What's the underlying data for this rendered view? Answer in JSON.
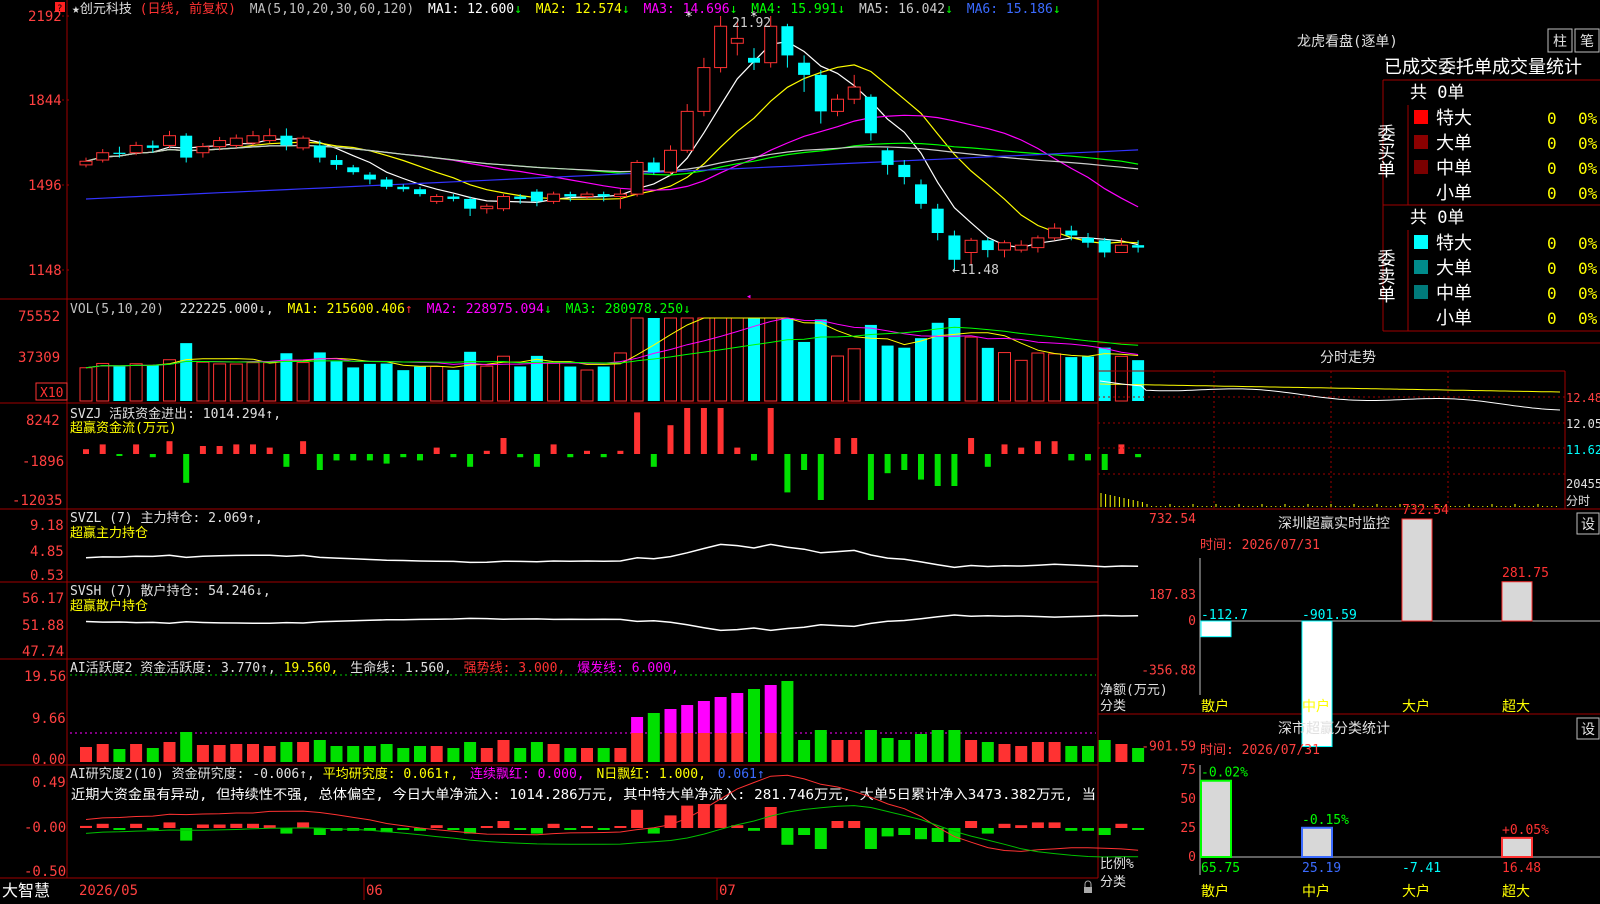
{
  "colors": {
    "up": "#ff3232",
    "down": "#00ffff",
    "flow_neg": "#00e000",
    "ma1": "#ffffff",
    "ma2": "#ffff00",
    "ma3": "#ff00ff",
    "ma4": "#00ff00",
    "ma5": "#cccccc",
    "ma6": "#3333ff",
    "axis": "#c01010",
    "label_yellow": "#ffff00",
    "magenta": "#ff00ff"
  },
  "corner_marker": "?",
  "app_name": "大智慧",
  "lock_icon": "lock-icon",
  "main_chart": {
    "stock_name": "★创元科技",
    "period_label": "(日线, 前复权)",
    "ma_title": "MA(5,10,20,30,60,120)",
    "ma_labels": [
      {
        "text": "MA1: 12.600",
        "arrow": "↓",
        "color_key": "ma1"
      },
      {
        "text": "MA2: 12.574",
        "arrow": "↓",
        "color_key": "ma2"
      },
      {
        "text": "MA3: 14.696",
        "arrow": "↓",
        "color_key": "ma3"
      },
      {
        "text": "MA4: 15.991",
        "arrow": "↓",
        "color_key": "ma4"
      },
      {
        "text": "MA5: 16.042",
        "arrow": "↓",
        "color_key": "ma5"
      },
      {
        "text": "MA6: 15.186",
        "arrow": "↓",
        "color_key": "ma6"
      }
    ],
    "y_ticks": [
      "2192",
      "1844",
      "1496",
      "1148"
    ],
    "high_label": "21.92",
    "low_label": "←11.48"
  },
  "candles": [
    [
      15.8,
      15.95,
      16.1,
      15.7
    ],
    [
      16.0,
      16.3,
      16.45,
      15.9
    ],
    [
      16.3,
      16.25,
      16.55,
      16.1
    ],
    [
      16.3,
      16.6,
      16.75,
      16.2
    ],
    [
      16.6,
      16.5,
      16.8,
      16.3
    ],
    [
      16.6,
      17.0,
      17.2,
      16.5
    ],
    [
      17.0,
      16.1,
      17.1,
      15.9
    ],
    [
      16.3,
      16.55,
      16.7,
      16.1
    ],
    [
      16.55,
      16.8,
      16.95,
      16.4
    ],
    [
      16.6,
      16.9,
      17.05,
      16.5
    ],
    [
      16.7,
      17.0,
      17.2,
      16.6
    ],
    [
      16.8,
      17.0,
      17.3,
      16.7
    ],
    [
      17.0,
      16.6,
      17.3,
      16.4
    ],
    [
      16.5,
      16.9,
      17.0,
      16.4
    ],
    [
      16.6,
      16.1,
      16.8,
      15.9
    ],
    [
      16.0,
      15.8,
      16.2,
      15.6
    ],
    [
      15.7,
      15.5,
      15.8,
      15.4
    ],
    [
      15.4,
      15.2,
      15.5,
      15.0
    ],
    [
      15.2,
      14.9,
      15.3,
      14.8
    ],
    [
      14.9,
      14.8,
      15.0,
      14.7
    ],
    [
      14.8,
      14.6,
      14.9,
      14.5
    ],
    [
      14.3,
      14.5,
      14.6,
      14.2
    ],
    [
      14.5,
      14.4,
      14.6,
      14.3
    ],
    [
      14.4,
      14.0,
      14.5,
      13.7
    ],
    [
      14.0,
      14.1,
      14.2,
      13.8
    ],
    [
      14.0,
      14.5,
      14.6,
      13.9
    ],
    [
      14.5,
      14.4,
      14.6,
      14.2
    ],
    [
      14.7,
      14.3,
      14.8,
      14.1
    ],
    [
      14.3,
      14.6,
      14.7,
      14.2
    ],
    [
      14.6,
      14.5,
      14.7,
      14.3
    ],
    [
      14.5,
      14.6,
      14.7,
      14.4
    ],
    [
      14.6,
      14.5,
      14.7,
      14.3
    ],
    [
      14.5,
      14.6,
      14.8,
      14.0
    ],
    [
      14.6,
      15.9,
      16.0,
      14.5
    ],
    [
      15.9,
      15.5,
      16.1,
      15.4
    ],
    [
      15.5,
      16.4,
      16.6,
      15.4
    ],
    [
      16.4,
      18.0,
      18.3,
      16.3
    ],
    [
      18.0,
      19.8,
      20.2,
      17.8
    ],
    [
      19.8,
      21.5,
      21.92,
      19.6
    ],
    [
      20.8,
      21.0,
      21.7,
      20.3
    ],
    [
      20.2,
      20.0,
      20.6,
      19.7
    ],
    [
      20.0,
      21.5,
      21.92,
      19.8
    ],
    [
      21.5,
      20.3,
      21.6,
      19.8
    ],
    [
      20.0,
      19.5,
      20.3,
      18.8
    ],
    [
      19.5,
      18.0,
      19.7,
      17.5
    ],
    [
      18.0,
      18.5,
      18.7,
      17.8
    ],
    [
      18.5,
      19.0,
      19.5,
      18.3
    ],
    [
      18.6,
      17.1,
      18.7,
      16.8
    ],
    [
      16.4,
      15.8,
      16.5,
      15.4
    ],
    [
      15.8,
      15.3,
      16.0,
      15.0
    ],
    [
      15.0,
      14.2,
      15.2,
      14.0
    ],
    [
      14.0,
      13.0,
      14.2,
      12.7
    ],
    [
      12.9,
      11.9,
      13.1,
      11.48
    ],
    [
      12.2,
      12.7,
      12.8,
      11.7
    ],
    [
      12.7,
      12.3,
      12.8,
      12.0
    ],
    [
      12.3,
      12.6,
      12.7,
      12.0
    ],
    [
      12.3,
      12.5,
      12.7,
      12.2
    ],
    [
      12.4,
      12.8,
      12.9,
      12.2
    ],
    [
      12.8,
      13.2,
      13.4,
      12.7
    ],
    [
      13.1,
      12.9,
      13.3,
      12.7
    ],
    [
      12.8,
      12.6,
      13.0,
      12.4
    ],
    [
      12.7,
      12.2,
      12.8,
      12.0
    ],
    [
      12.2,
      12.5,
      12.8,
      12.2
    ],
    [
      12.5,
      12.4,
      12.7,
      12.2
    ]
  ],
  "vol_panel": {
    "title": "VOL(5,10,20)",
    "value": "222225.000↓,",
    "ma_labels": [
      {
        "text": "MA1: 215600.406",
        "arrow": "↑",
        "color_key": "ma2"
      },
      {
        "text": "MA2: 228975.094",
        "arrow": "↓",
        "color_key": "ma3"
      },
      {
        "text": "MA3: 280978.250",
        "arrow": "↓",
        "color_key": "ma4"
      }
    ],
    "y_ticks": [
      "75552",
      "37309"
    ],
    "unit_box": "X10"
  },
  "flow_panel": {
    "title": "SVZJ  活跃资金进出: 1014.294↑,",
    "subtitle": "超赢资金流(万元)",
    "y_ticks": [
      "8242",
      "-1896",
      "-12035"
    ]
  },
  "main_hold_panel": {
    "title": "SVZL (7) 主力持仓: 2.069↑,",
    "subtitle": "超赢主力持仓",
    "y_ticks": [
      "9.18",
      "4.85",
      "0.53"
    ]
  },
  "retail_hold_panel": {
    "title": "SVSH (7) 散户持仓: 54.246↓,",
    "subtitle": "超赢散户持仓",
    "y_ticks": [
      "56.17",
      "51.88",
      "47.74"
    ]
  },
  "activity_panel": {
    "title": "AI活跃度2 资金活跃度: 3.770↑,",
    "v2": "19.560,",
    "v3": "生命线: 1.560,",
    "v4": "强势线: 3.000,",
    "v5": "爆发线: 6.000,",
    "y_ticks": [
      "19.56",
      "9.66",
      "0.00"
    ]
  },
  "research_panel": {
    "title": "AI研究度2(10) 资金研究度: -0.006↑,",
    "v2": "平均研究度: 0.061↑,",
    "v3": "连续飘红: 0.000,",
    "v4": "N日飘红: 1.000,",
    "v5": "0.061↑",
    "comment": "近期大资金虽有异动, 但持续性不强, 总体偏空, 今日大单净流入: 1014.286万元, 其中特大单净流入: 281.746万元, 大单5日累计净入3473.382万元, 当",
    "y_ticks": [
      "0.49",
      "-0.00",
      "-0.50"
    ]
  },
  "date_axis": {
    "labels": [
      "2026/05",
      "06",
      "07"
    ]
  },
  "longhu": {
    "title": "龙虎看盘(逐单)",
    "btn1": "柱",
    "btn2": "笔",
    "header": "已成交委托单成交量统计",
    "buy_label": "委买单",
    "sell_label": "委卖单",
    "buy_total": "共 0单",
    "sell_total": "共 0单",
    "buy_rows": [
      {
        "name": "特大",
        "count": "0",
        "pct": "0%",
        "color": "#ff0000"
      },
      {
        "name": "大单",
        "count": "0",
        "pct": "0%",
        "color": "#8b0000"
      },
      {
        "name": "中单",
        "count": "0",
        "pct": "0%",
        "color": "#7a0000"
      },
      {
        "name": "小单",
        "count": "0",
        "pct": "0%",
        "color": ""
      }
    ],
    "sell_rows": [
      {
        "name": "特大",
        "count": "0",
        "pct": "0%",
        "color": "#00ffff"
      },
      {
        "name": "大单",
        "count": "0",
        "pct": "0%",
        "color": "#008b8b"
      },
      {
        "name": "中单",
        "count": "0",
        "pct": "0%",
        "color": "#007a7a"
      },
      {
        "name": "小单",
        "count": "0",
        "pct": "0%",
        "color": ""
      }
    ]
  },
  "intraday": {
    "title": "分时走势",
    "price_labels": [
      "12.48",
      "12.05",
      "11.62"
    ],
    "vol_label": "20455",
    "unit": "分时"
  },
  "sz_monitor": {
    "title": "深圳超赢实时监控",
    "settings": "设",
    "time_label": "时间: 2026/07/31",
    "y_ticks": [
      "732.54",
      "187.83",
      "0",
      "-356.88",
      "-901.59"
    ],
    "axis_label1": "净额(万元)",
    "axis_label2": "分类",
    "categories": [
      "散户",
      "中户",
      "大户",
      "超大"
    ],
    "values": [
      -112.7,
      -901.59,
      732.54,
      281.75
    ],
    "value_labels": [
      "-112.7",
      "-901.59",
      "732.54",
      "281.75"
    ]
  },
  "sz_class": {
    "title": "深市超赢分类统计",
    "settings": "设",
    "time_label": "时间: 2026/07/31",
    "y_ticks": [
      "75",
      "50",
      "25",
      "0"
    ],
    "axis_label1": "比例%",
    "axis_label2": "分类",
    "categories": [
      "散户",
      "中户",
      "大户",
      "超大"
    ],
    "bar_values": [
      65.75,
      25.19,
      0,
      16.48
    ],
    "top_labels": [
      "-0.02%",
      "-0.15%",
      "",
      "+0.05%"
    ],
    "bottom_labels": [
      "65.75",
      "25.19",
      "-7.41",
      "16.48"
    ]
  }
}
